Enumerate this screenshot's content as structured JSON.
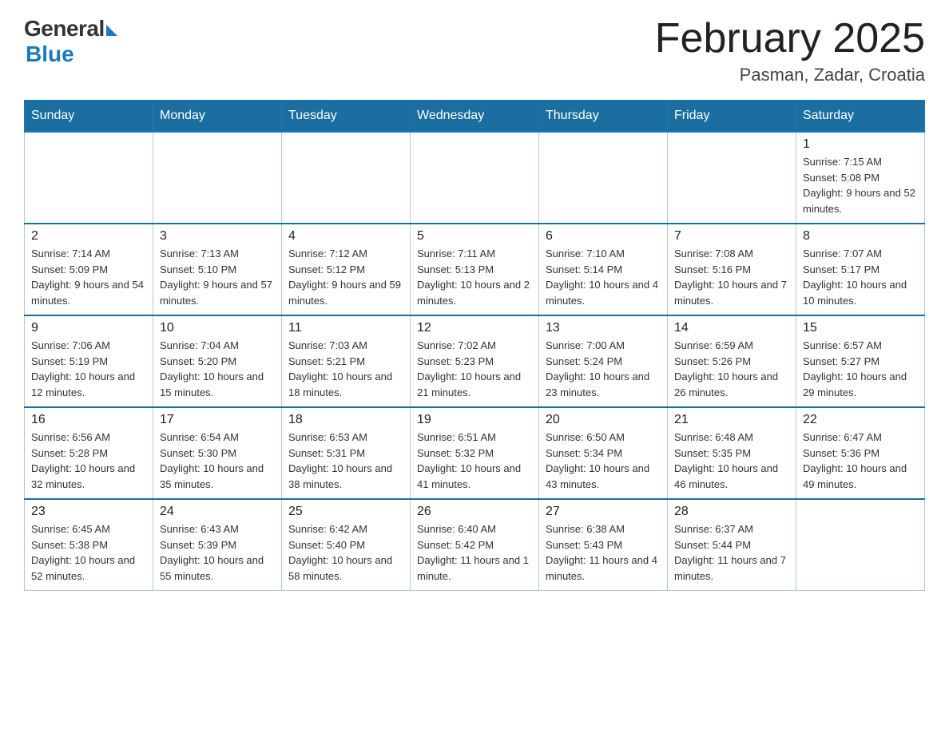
{
  "header": {
    "logo_general": "General",
    "logo_blue": "Blue",
    "title": "February 2025",
    "location": "Pasman, Zadar, Croatia"
  },
  "days_of_week": [
    "Sunday",
    "Monday",
    "Tuesday",
    "Wednesday",
    "Thursday",
    "Friday",
    "Saturday"
  ],
  "weeks": [
    [
      {
        "day": "",
        "info": ""
      },
      {
        "day": "",
        "info": ""
      },
      {
        "day": "",
        "info": ""
      },
      {
        "day": "",
        "info": ""
      },
      {
        "day": "",
        "info": ""
      },
      {
        "day": "",
        "info": ""
      },
      {
        "day": "1",
        "info": "Sunrise: 7:15 AM\nSunset: 5:08 PM\nDaylight: 9 hours and 52 minutes."
      }
    ],
    [
      {
        "day": "2",
        "info": "Sunrise: 7:14 AM\nSunset: 5:09 PM\nDaylight: 9 hours and 54 minutes."
      },
      {
        "day": "3",
        "info": "Sunrise: 7:13 AM\nSunset: 5:10 PM\nDaylight: 9 hours and 57 minutes."
      },
      {
        "day": "4",
        "info": "Sunrise: 7:12 AM\nSunset: 5:12 PM\nDaylight: 9 hours and 59 minutes."
      },
      {
        "day": "5",
        "info": "Sunrise: 7:11 AM\nSunset: 5:13 PM\nDaylight: 10 hours and 2 minutes."
      },
      {
        "day": "6",
        "info": "Sunrise: 7:10 AM\nSunset: 5:14 PM\nDaylight: 10 hours and 4 minutes."
      },
      {
        "day": "7",
        "info": "Sunrise: 7:08 AM\nSunset: 5:16 PM\nDaylight: 10 hours and 7 minutes."
      },
      {
        "day": "8",
        "info": "Sunrise: 7:07 AM\nSunset: 5:17 PM\nDaylight: 10 hours and 10 minutes."
      }
    ],
    [
      {
        "day": "9",
        "info": "Sunrise: 7:06 AM\nSunset: 5:19 PM\nDaylight: 10 hours and 12 minutes."
      },
      {
        "day": "10",
        "info": "Sunrise: 7:04 AM\nSunset: 5:20 PM\nDaylight: 10 hours and 15 minutes."
      },
      {
        "day": "11",
        "info": "Sunrise: 7:03 AM\nSunset: 5:21 PM\nDaylight: 10 hours and 18 minutes."
      },
      {
        "day": "12",
        "info": "Sunrise: 7:02 AM\nSunset: 5:23 PM\nDaylight: 10 hours and 21 minutes."
      },
      {
        "day": "13",
        "info": "Sunrise: 7:00 AM\nSunset: 5:24 PM\nDaylight: 10 hours and 23 minutes."
      },
      {
        "day": "14",
        "info": "Sunrise: 6:59 AM\nSunset: 5:26 PM\nDaylight: 10 hours and 26 minutes."
      },
      {
        "day": "15",
        "info": "Sunrise: 6:57 AM\nSunset: 5:27 PM\nDaylight: 10 hours and 29 minutes."
      }
    ],
    [
      {
        "day": "16",
        "info": "Sunrise: 6:56 AM\nSunset: 5:28 PM\nDaylight: 10 hours and 32 minutes."
      },
      {
        "day": "17",
        "info": "Sunrise: 6:54 AM\nSunset: 5:30 PM\nDaylight: 10 hours and 35 minutes."
      },
      {
        "day": "18",
        "info": "Sunrise: 6:53 AM\nSunset: 5:31 PM\nDaylight: 10 hours and 38 minutes."
      },
      {
        "day": "19",
        "info": "Sunrise: 6:51 AM\nSunset: 5:32 PM\nDaylight: 10 hours and 41 minutes."
      },
      {
        "day": "20",
        "info": "Sunrise: 6:50 AM\nSunset: 5:34 PM\nDaylight: 10 hours and 43 minutes."
      },
      {
        "day": "21",
        "info": "Sunrise: 6:48 AM\nSunset: 5:35 PM\nDaylight: 10 hours and 46 minutes."
      },
      {
        "day": "22",
        "info": "Sunrise: 6:47 AM\nSunset: 5:36 PM\nDaylight: 10 hours and 49 minutes."
      }
    ],
    [
      {
        "day": "23",
        "info": "Sunrise: 6:45 AM\nSunset: 5:38 PM\nDaylight: 10 hours and 52 minutes."
      },
      {
        "day": "24",
        "info": "Sunrise: 6:43 AM\nSunset: 5:39 PM\nDaylight: 10 hours and 55 minutes."
      },
      {
        "day": "25",
        "info": "Sunrise: 6:42 AM\nSunset: 5:40 PM\nDaylight: 10 hours and 58 minutes."
      },
      {
        "day": "26",
        "info": "Sunrise: 6:40 AM\nSunset: 5:42 PM\nDaylight: 11 hours and 1 minute."
      },
      {
        "day": "27",
        "info": "Sunrise: 6:38 AM\nSunset: 5:43 PM\nDaylight: 11 hours and 4 minutes."
      },
      {
        "day": "28",
        "info": "Sunrise: 6:37 AM\nSunset: 5:44 PM\nDaylight: 11 hours and 7 minutes."
      },
      {
        "day": "",
        "info": ""
      }
    ]
  ]
}
